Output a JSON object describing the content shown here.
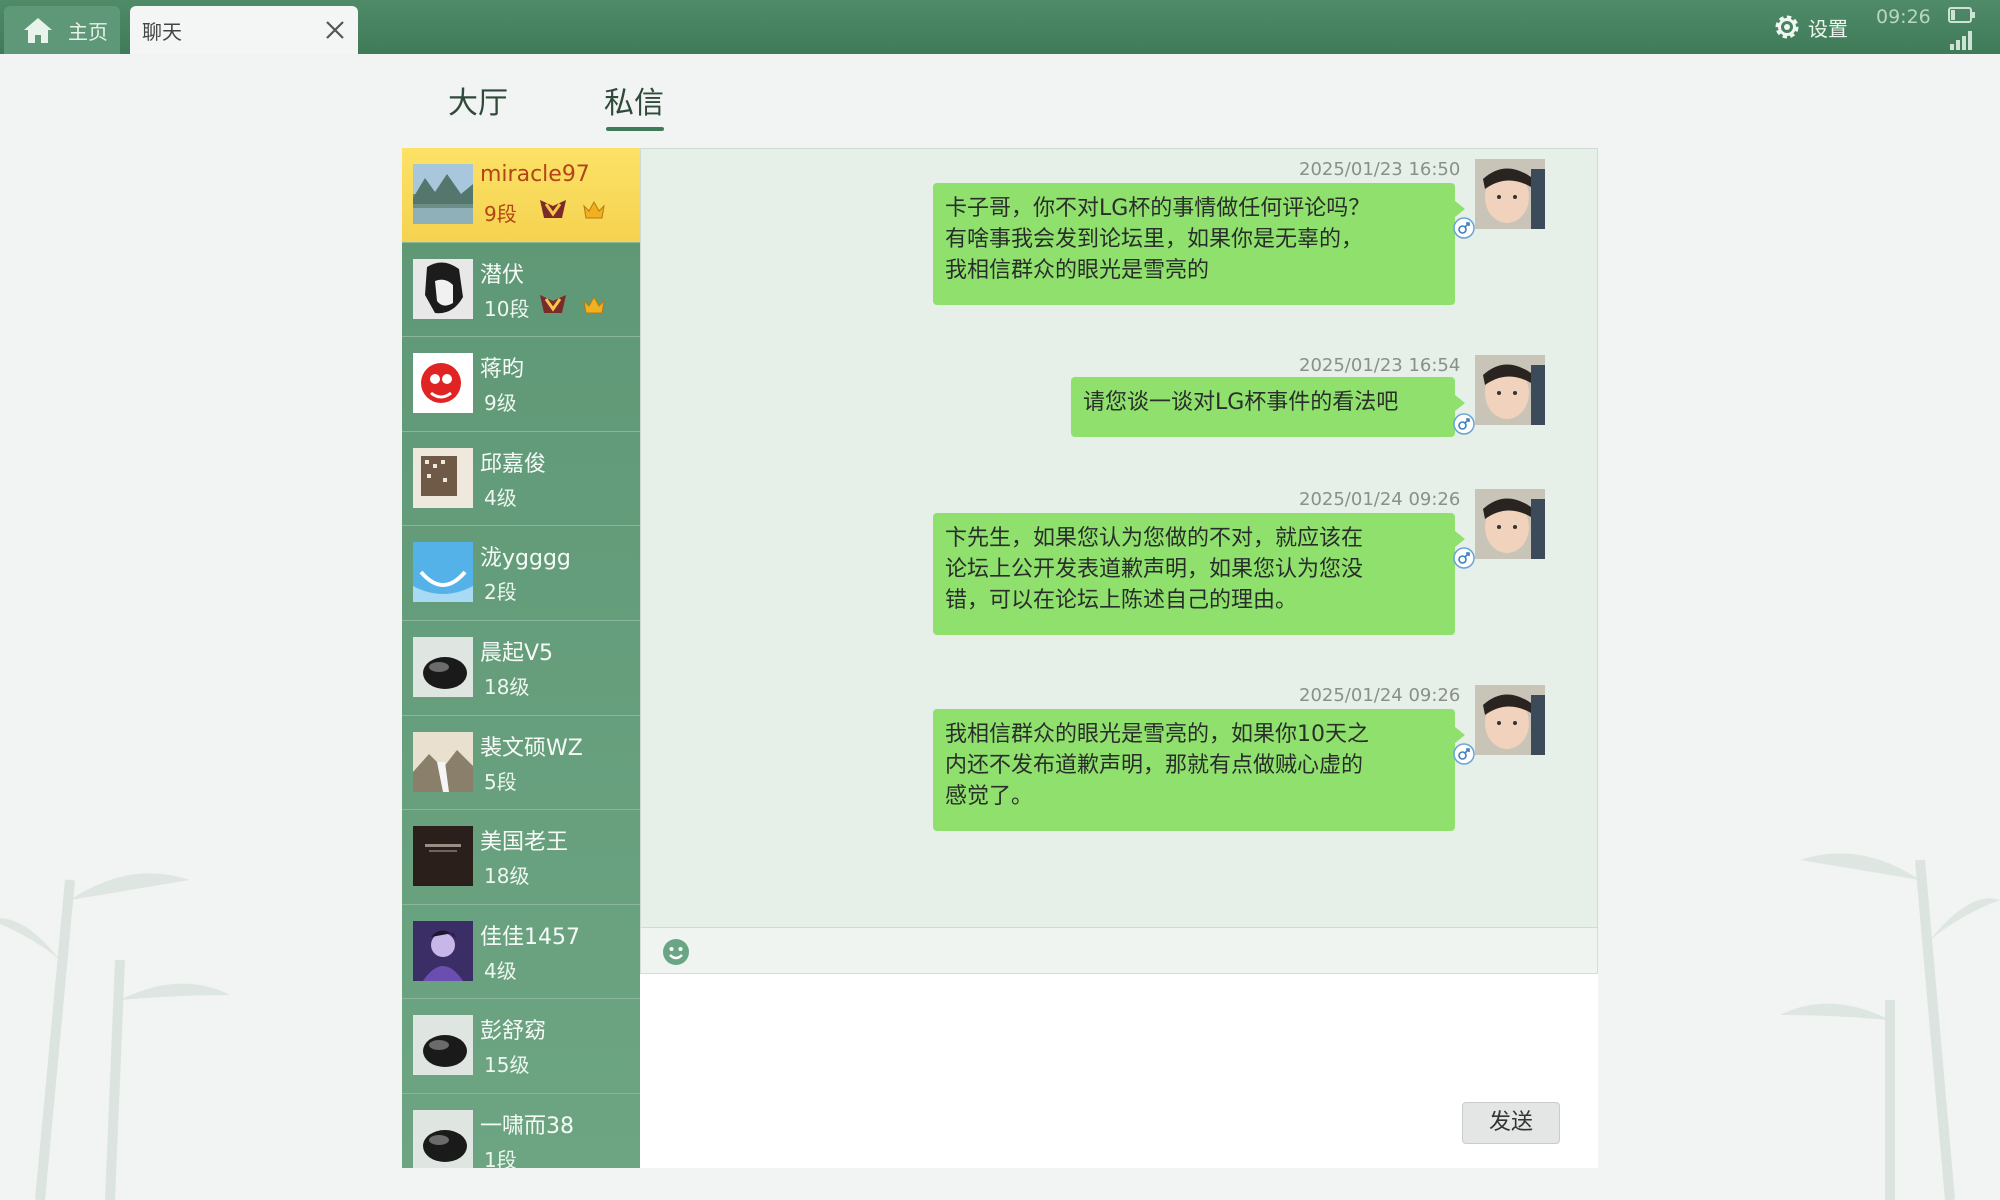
{
  "top_bar": {
    "home_tab_label": "主页",
    "chat_tab_label": "聊天",
    "settings_label": "设置",
    "clock": "09:26"
  },
  "sub_tabs": [
    {
      "label": "大厅",
      "active": false
    },
    {
      "label": "私信",
      "active": true
    }
  ],
  "contacts": [
    {
      "name": "miracle97",
      "rank": "9段",
      "badges": [
        "vip-badge-icon",
        "crown-icon"
      ],
      "active": true
    },
    {
      "name": "潜伏",
      "rank": "10段",
      "badges": [
        "vip-badge-icon",
        "crown-icon"
      ],
      "active": false
    },
    {
      "name": "蒋昀",
      "rank": "9级",
      "badges": [],
      "active": false
    },
    {
      "name": "邱嘉俊",
      "rank": "4级",
      "badges": [],
      "active": false
    },
    {
      "name": "泷ygggg",
      "rank": "2段",
      "badges": [],
      "active": false
    },
    {
      "name": "晨起V5",
      "rank": "18级",
      "badges": [],
      "active": false
    },
    {
      "name": "裴文硕WZ",
      "rank": "5段",
      "badges": [],
      "active": false
    },
    {
      "name": "美国老王",
      "rank": "18级",
      "badges": [],
      "active": false
    },
    {
      "name": "佳佳1457",
      "rank": "4级",
      "badges": [],
      "active": false
    },
    {
      "name": "彭舒窈",
      "rank": "15级",
      "badges": [],
      "active": false
    },
    {
      "name": "一啸而38",
      "rank": "1段",
      "badges": [],
      "active": false
    }
  ],
  "messages": [
    {
      "time": "2025/01/23 16:50",
      "lines": [
        "卡子哥，你不对LG杯的事情做任何评论吗？",
        "有啥事我会发到论坛里，如果你是无辜的，",
        "我相信群众的眼光是雪亮的"
      ]
    },
    {
      "time": "2025/01/23 16:54",
      "lines": [
        "请您谈一谈对LG杯事件的看法吧"
      ]
    },
    {
      "time": "2025/01/24 09:26",
      "lines": [
        "卞先生，如果您认为您做的不对，就应该在",
        "论坛上公开发表道歉声明，如果您认为您没",
        "错，可以在论坛上陈述自己的理由。"
      ]
    },
    {
      "time": "2025/01/24 09:26",
      "lines": [
        "我相信群众的眼光是雪亮的，如果你10天之",
        "内还不发布道歉声明，那就有点做贼心虚的",
        "感觉了。"
      ]
    }
  ],
  "input": {
    "send_label": "发送"
  },
  "colors": {
    "top_bar": "#4a8562",
    "sidebar": "#65a07c",
    "active_contact": "#f8d95a",
    "bubble": "#8fe06c",
    "chat_background": "#e6efe8"
  }
}
